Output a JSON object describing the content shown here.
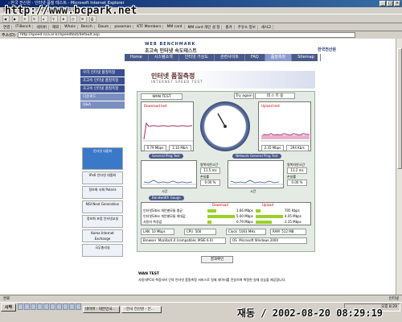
{
  "window": {
    "title": "::한국 전산원 - 인터넷 품질 테스트 - Microsoft Internet Explorer",
    "watermark": "http://www.bcpark.net"
  },
  "menu": "파일(F)  편집(E)  보기(V)  즐겨찾기(A)  도구(T)  도움말(H)",
  "links": [
    "연결",
    "IT-Bench",
    "네이버",
    "해외",
    "Whois",
    "Bench",
    "Daum",
    "paxoman",
    "KTF Members",
    "MM card",
    "MM card 개인 설 정",
    "즐겨",
    "주유소 정보",
    "새사고"
  ],
  "address": {
    "label": "주소(D)",
    "url": "http://speed.nca.or.kr/speedtest/default.asp"
  },
  "site": {
    "logo_small": "WEB BENCHMARK",
    "logo_main": "초고속 인터넷 속도테스트",
    "org": "한국전산원",
    "nav": [
      "Home",
      "시스템소개",
      "인터넷 가상도",
      "관련사이트",
      "FAQ",
      "품질측정",
      "Sitemap"
    ],
    "side_menu": [
      "우리 인터넷 품질측정",
      "초고속 인터넷 품질측정",
      "초고속 인터넷 품질측정",
      "다운로드",
      "Q&A"
    ],
    "side_ads": [
      "인터넷 대중화",
      "IPv6 인터넷 대중화",
      "정보화 사회 Polaris",
      "NGI Next Generation",
      "정보화 포럼 인터넷교실",
      "Korea Internet Exchange",
      "국무총리실"
    ],
    "banner_title": "인터넷 품질측정",
    "banner_sub": "INTERNET SPEED TEST",
    "tab": "WAN TEST",
    "try_again": "Try again",
    "test_sel": "테 스 트 용",
    "download_title": "Download test",
    "upload_title": "Upload test",
    "dl_vals": [
      "0.79 Mbps",
      "1.10 Mb/s"
    ],
    "ul_vals": [
      "2.35 Mbps",
      "294 Kb/s"
    ],
    "gen_ping": "General Ping Test",
    "net_ping": "Network General Ping Test",
    "rtt_label": "왕복지연시간",
    "rtt_a": "11.5 ms",
    "rtt_b": "13.2 ms",
    "loss_label": "손실률",
    "loss_a": "0.00 %",
    "loss_b": "0.00 %",
    "time_label": "시간",
    "bw_title": "Bandwidth Gauge",
    "bw_headers": [
      "Download",
      "Upload"
    ],
    "bw_rows": [
      {
        "label": "인터넷Sites 개인별모듈 평균",
        "down": "1.66 Mbps",
        "up": "705 Kbps"
      },
      {
        "label": "인터넷Sites 개인별모듈 최대값",
        "down": "5.00 Mbps",
        "up": "4.05 Mbps"
      },
      {
        "label": "사용자 측정값",
        "down": "0.79 Mbps",
        "up": "2.35 Mbps"
      }
    ],
    "bw_fill_down": [
      0.33,
      1.0,
      0.16
    ],
    "bw_fill_up": [
      0.17,
      1.0,
      0.58
    ],
    "sys": {
      "lan_k": "LAN",
      "lan_v": "10 Mbps",
      "cpu_k": "CPU",
      "cpu_v": "500",
      "clock_k": "Clock",
      "clock_v": "1003 MHz",
      "ram_k": "RAM",
      "ram_v": "512 MB",
      "browser_k": "Browser",
      "browser_v": "Mozilla/4.0 (compatible; MSIE 6.0)",
      "os_k": "OS",
      "os_v": "Microsoft Windows 2000"
    },
    "result_btn": "결과확인",
    "wan_head": "WAN TEST",
    "wan_desc": "사용자PC와 측정서버 간의 인터넷 품질측정 서비스로 실제 데이터를 전송하여 측정한 실제 성능을 제공합니다."
  },
  "status": {
    "left": "완료",
    "zone": "인터넷"
  },
  "taskbar": {
    "start": "시작",
    "tasks": [
      "네이버 : 대한민국...",
      "::한국 전산원 - 인..."
    ],
    "tray": "오후 8:29"
  },
  "stamp": "재동 / 2002-08-20 08:29:19"
}
